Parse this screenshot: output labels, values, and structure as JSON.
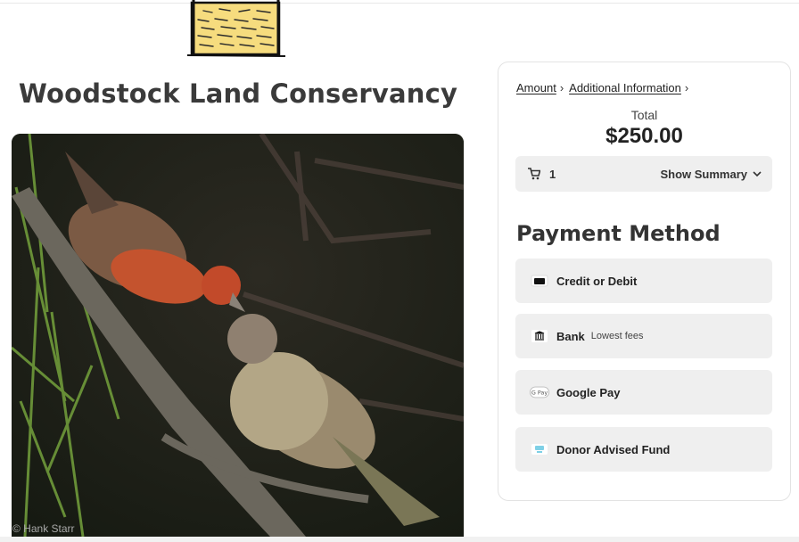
{
  "organization": {
    "name": "Woodstock Land Conservancy"
  },
  "photo": {
    "credit": "© Hank Starr"
  },
  "breadcrumb": {
    "step1": "Amount",
    "step2": "Additional Information"
  },
  "total": {
    "label": "Total",
    "amount": "$250.00"
  },
  "summary": {
    "quantity": "1",
    "toggle_label": "Show Summary"
  },
  "payment": {
    "heading": "Payment Method",
    "options": [
      {
        "label": "Credit or Debit",
        "sub": "",
        "icon": "credit-card-icon"
      },
      {
        "label": "Bank",
        "sub": "Lowest fees",
        "icon": "bank-icon"
      },
      {
        "label": "Google Pay",
        "sub": "",
        "icon": "google-pay-icon"
      },
      {
        "label": "Donor Advised Fund",
        "sub": "",
        "icon": "donor-advised-fund-icon"
      }
    ]
  },
  "colors": {
    "logo_fill": "#f6dc7e",
    "option_bg": "#efefef",
    "text": "#222222"
  }
}
